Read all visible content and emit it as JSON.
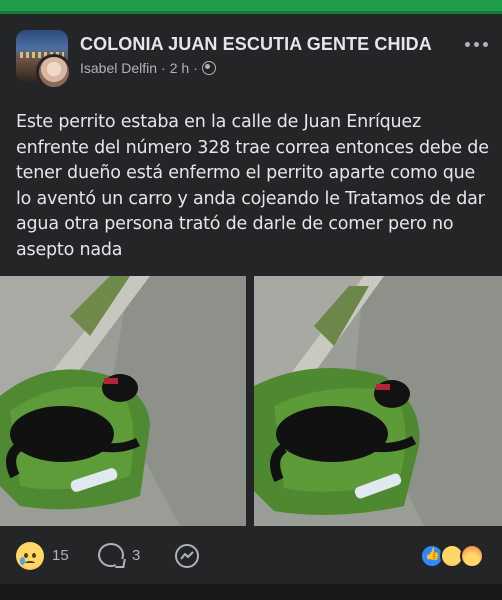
{
  "post": {
    "group_name": "COLONIA JUAN ESCUTIA GENTE CHIDA",
    "author": "Isabel Delfin",
    "time": "2 h",
    "separator": "·",
    "text": "Este perrito estaba en la calle de Juan Enríquez enfrente del número 328 trae correa entonces debe de tener dueño está enfermo el perrito aparte como que lo aventó un carro y anda cojeando le Tratamos de dar agua otra persona trató de darle de comer pero no asepto nada"
  },
  "icons": {
    "privacy": "globe-icon",
    "more": "more-options-icon",
    "comment": "comment-icon",
    "share": "messenger-icon",
    "reaction": "sad-reaction-icon"
  },
  "actions": {
    "reaction_count": "15",
    "comment_count": "3"
  },
  "colors": {
    "background": "#242526",
    "text": "#e4e6eb",
    "secondary_text": "#b0b3b8",
    "top_strip": "#1e9e4a",
    "like_blue": "#2e89ff"
  }
}
